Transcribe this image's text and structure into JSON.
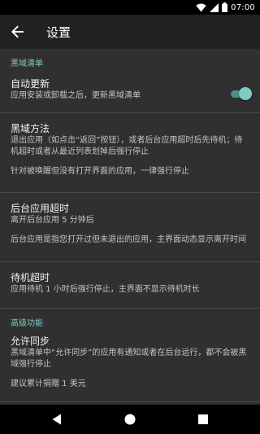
{
  "status_bar": {
    "time": "07:00",
    "icons": [
      "wifi-icon",
      "signal-icon",
      "battery-icon"
    ]
  },
  "app_bar": {
    "title": "设置",
    "back_icon": "arrow-back-icon"
  },
  "sections": {
    "blacklist": {
      "header": "黑域清单",
      "auto_update": {
        "title": "自动更新",
        "summary": "应用安装或卸载之后，更新黑域清单",
        "enabled": true
      },
      "method": {
        "title": "黑域方法",
        "summary": "退出应用（如点击“返回”按钮），或者后台应用超时后先待机；待机超时或者从最近列表划掉后强行停止",
        "note": "针对被唤醒但没有打开界面的应用，一律强行停止"
      },
      "background_timeout": {
        "title": "后台应用超时",
        "summary": "离开后台应用 5 分钟后",
        "note": "后台应用是指您打开过但未退出的应用，主界面动态显示离开时间"
      },
      "standby_timeout": {
        "title": "待机超时",
        "summary": "应用待机 1 小时后强行停止，主界面不显示待机时长"
      }
    },
    "advanced": {
      "header": "高级功能",
      "allow_sync": {
        "title": "允许同步",
        "summary": "黑域清单中“允许同步”的应用有通知或者在后台运行，都不会被黑域强行停止",
        "note": "建议累计捐赠 1 美元"
      }
    }
  },
  "nav_bar": {
    "icons": [
      "back-triangle-icon",
      "home-circle-icon",
      "recents-square-icon"
    ]
  },
  "colors": {
    "accent": "#80cbc4",
    "app_bar": "#212121",
    "background": "#303030"
  }
}
